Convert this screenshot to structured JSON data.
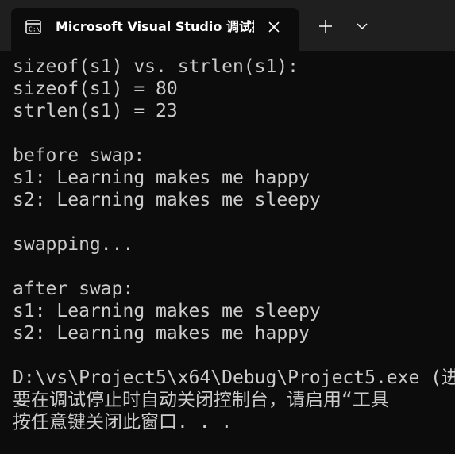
{
  "titlebar": {
    "tab_title": "Microsoft Visual Studio 调试控制台",
    "tab_icon": "console-app-icon",
    "close_icon": "close-icon",
    "new_tab_icon": "plus-icon",
    "dropdown_icon": "chevron-down-icon"
  },
  "console": {
    "lines": [
      "sizeof(s1) vs. strlen(s1):",
      "sizeof(s1) = 80",
      "strlen(s1) = 23",
      "",
      "before swap:",
      "s1: Learning makes me happy",
      "s2: Learning makes me sleepy",
      "",
      "swapping...",
      "",
      "after swap:",
      "s1: Learning makes me sleepy",
      "s2: Learning makes me happy",
      "",
      "D:\\vs\\Project5\\x64\\Debug\\Project5.exe (进",
      "要在调试停止时自动关闭控制台，请启用“工具",
      "按任意键关闭此窗口. . ."
    ]
  },
  "colors": {
    "background": "#0c0c0c",
    "titlebar": "#1f1f1f",
    "text": "#cccccc",
    "title_text": "#ffffff"
  }
}
